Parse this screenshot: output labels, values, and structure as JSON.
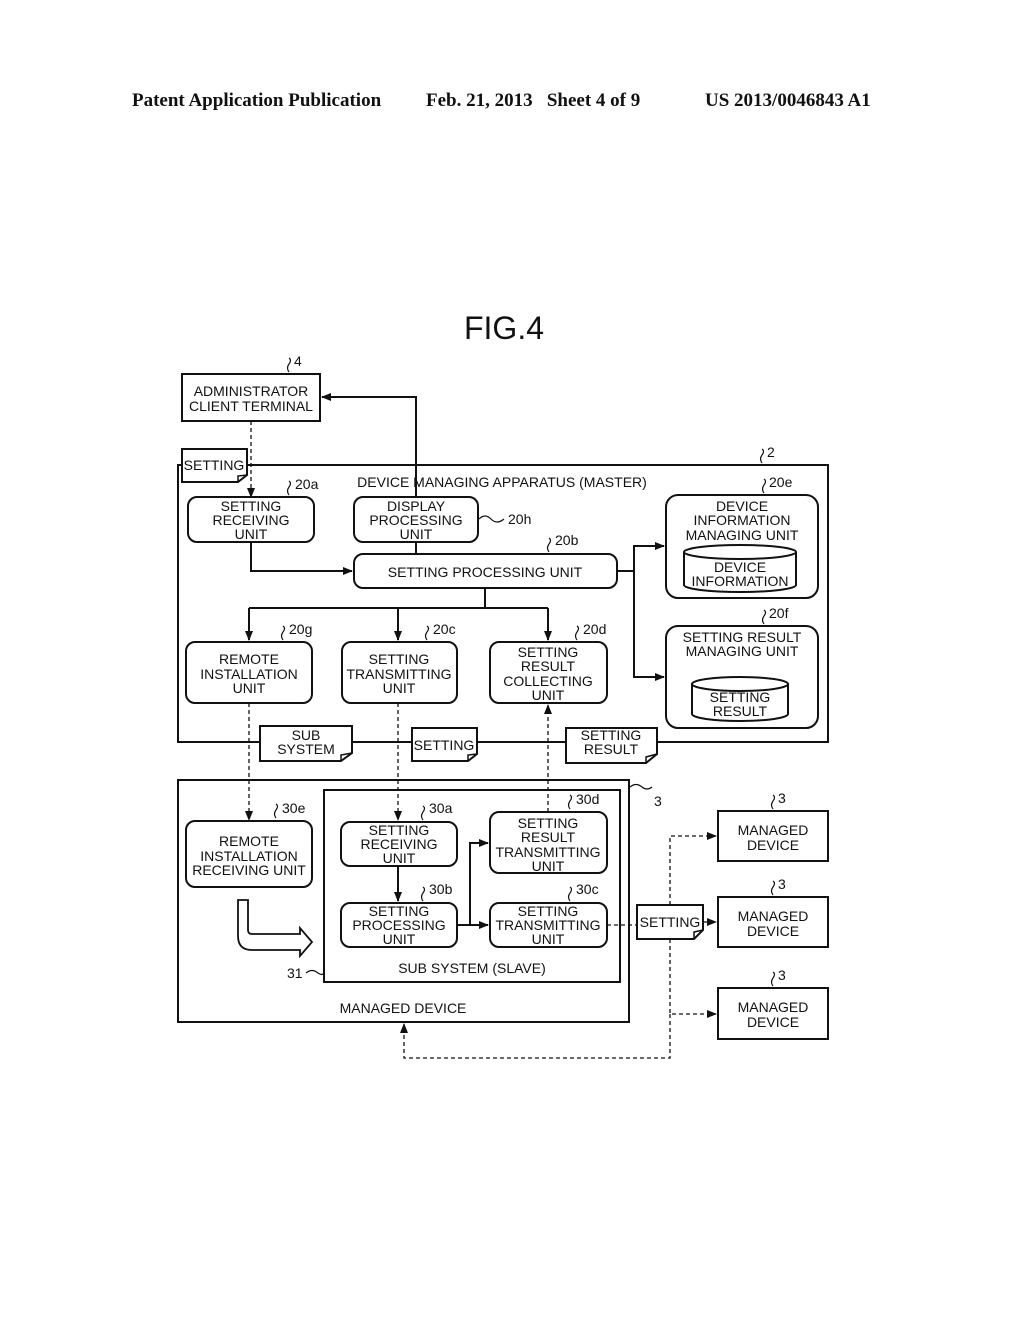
{
  "header": {
    "publication": "Patent Application Publication",
    "date_sheet": "Feb. 21, 2013   Sheet 4 of 9",
    "number": "US 2013/0046843 A1"
  },
  "figure": {
    "title": "FIG.4",
    "admin_terminal": {
      "ref": "4",
      "lines": [
        "ADMINISTRATOR",
        "CLIENT TERMINAL"
      ]
    },
    "master": {
      "ref": "2",
      "label": "DEVICE MANAGING APPARATUS (MASTER)",
      "setting_receiving": {
        "ref": "20a",
        "lines": [
          "SETTING",
          "RECEIVING",
          "UNIT"
        ]
      },
      "display_processing": {
        "ref": "20h",
        "lines": [
          "DISPLAY",
          "PROCESSING",
          "UNIT"
        ]
      },
      "setting_processing": {
        "ref": "20b",
        "label": "SETTING PROCESSING UNIT"
      },
      "device_info_mgr": {
        "ref": "20e",
        "lines": [
          "DEVICE",
          "INFORMATION",
          "MANAGING UNIT"
        ],
        "db": [
          "DEVICE",
          "INFORMATION"
        ]
      },
      "setting_result_mgr": {
        "ref": "20f",
        "lines": [
          "SETTING RESULT",
          "MANAGING UNIT"
        ],
        "db": [
          "SETTING",
          "RESULT"
        ]
      },
      "remote_installation": {
        "ref": "20g",
        "lines": [
          "REMOTE",
          "INSTALLATION",
          "UNIT"
        ]
      },
      "setting_transmitting": {
        "ref": "20c",
        "lines": [
          "SETTING",
          "TRANSMITTING",
          "UNIT"
        ]
      },
      "result_collecting": {
        "ref": "20d",
        "lines": [
          "SETTING",
          "RESULT",
          "COLLECTING",
          "UNIT"
        ]
      }
    },
    "documents": {
      "setting_top": "SETTING",
      "subsystem": [
        "SUB",
        "SYSTEM"
      ],
      "setting_mid": "SETTING",
      "setting_result": [
        "SETTING",
        "RESULT"
      ],
      "setting_right": "SETTING"
    },
    "managed_device": {
      "ref": "3",
      "label": "MANAGED DEVICE",
      "remote_receiving": {
        "ref": "30e",
        "lines": [
          "REMOTE",
          "INSTALLATION",
          "RECEIVING UNIT"
        ]
      },
      "subsystem": {
        "ref": "31",
        "label": "SUB SYSTEM (SLAVE)",
        "setting_receiving": {
          "ref": "30a",
          "lines": [
            "SETTING",
            "RECEIVING",
            "UNIT"
          ]
        },
        "setting_processing": {
          "ref": "30b",
          "lines": [
            "SETTING",
            "PROCESSING",
            "UNIT"
          ]
        },
        "result_transmitting": {
          "ref": "30d",
          "lines": [
            "SETTING",
            "RESULT",
            "TRANSMITTING",
            "UNIT"
          ]
        },
        "setting_transmitting": {
          "ref": "30c",
          "lines": [
            "SETTING",
            "TRANSMITTING",
            "UNIT"
          ]
        }
      }
    },
    "other_devices": [
      {
        "ref": "3",
        "lines": [
          "MANAGED",
          "DEVICE"
        ]
      },
      {
        "ref": "3",
        "lines": [
          "MANAGED",
          "DEVICE"
        ]
      },
      {
        "ref": "3",
        "lines": [
          "MANAGED",
          "DEVICE"
        ]
      }
    ]
  }
}
